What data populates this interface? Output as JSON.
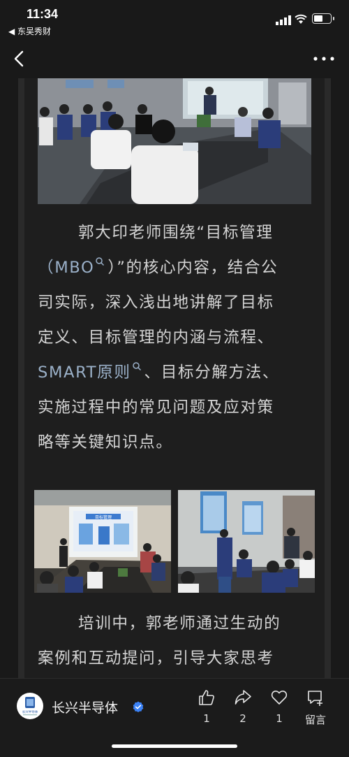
{
  "status_bar": {
    "time": "11:34",
    "back_app": "◀ 东吴秀财"
  },
  "nav": {
    "back_icon": "chevron-left-icon",
    "more_icon": "more-icon"
  },
  "article": {
    "paragraph1_lines": [
      "郭大印老师围绕“目标管理",
      "（MBO",
      "）”的核心内容，结合公",
      "司实际，深入浅出地讲解了目标",
      "定义、目标管理的内涵与流程、",
      "SMART原则",
      "、目标分解方法、",
      "实施过程中的常见问题及应对策",
      "略等关键知识点。"
    ],
    "paragraph2_lines": [
      "培训中，郭老师通过生动的",
      "案例和互动提问，引导大家思考"
    ],
    "photo_panel_text": "目标管理",
    "colors": {
      "link": "#9bb1c9",
      "text": "#d4d4d4",
      "background": "#191919"
    }
  },
  "account": {
    "name": "长兴半导体",
    "avatar_label": "长兴半导体",
    "verified_icon": "verified-badge-icon"
  },
  "actions": [
    {
      "icon": "thumbs-up-icon",
      "count": "1"
    },
    {
      "icon": "share-icon",
      "count": "2"
    },
    {
      "icon": "heart-icon",
      "count": "1"
    },
    {
      "icon": "comment-icon",
      "count": "留言"
    }
  ]
}
